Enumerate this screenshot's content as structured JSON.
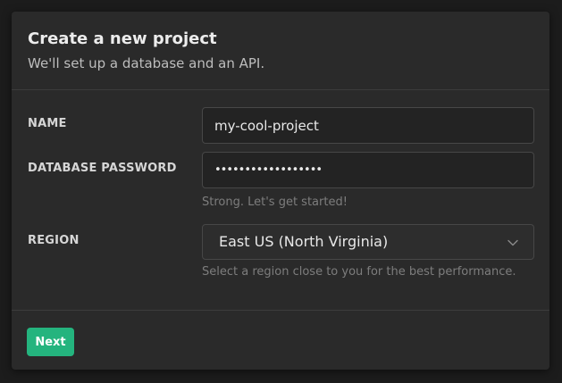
{
  "dialog": {
    "title": "Create a new project",
    "subtitle": "We'll set up a database and an API."
  },
  "form": {
    "name": {
      "label": "NAME",
      "value": "my-cool-project"
    },
    "password": {
      "label": "DATABASE PASSWORD",
      "value": "••••••••••••••••••",
      "hint": "Strong. Let's get started!"
    },
    "region": {
      "label": "REGION",
      "selected": "East US (North Virginia)",
      "hint": "Select a region close to you for the best performance."
    }
  },
  "footer": {
    "next_label": "Next"
  },
  "icons": {
    "region_dropdown": "chevron-down-icon"
  },
  "colors": {
    "accent": "#24b47e",
    "background": "#1c1c1c",
    "panel": "#2a2a2a"
  }
}
